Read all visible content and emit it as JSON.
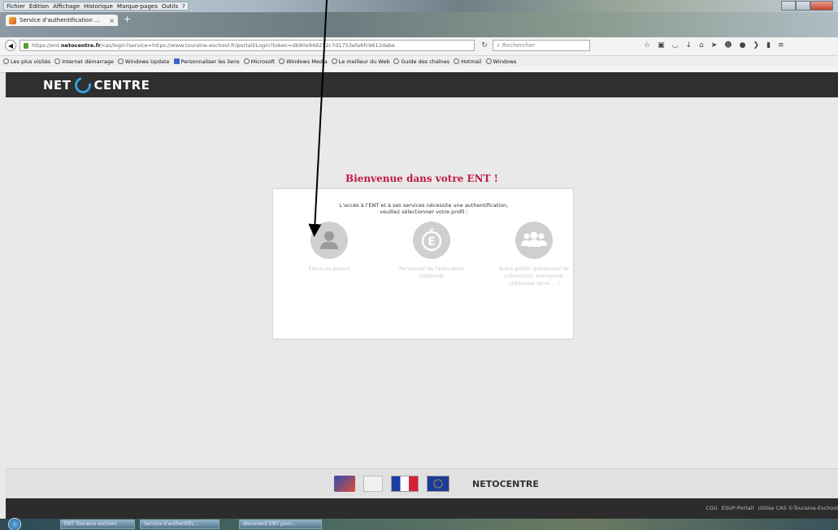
{
  "menubar": [
    "Fichier",
    "Édition",
    "Affichage",
    "Historique",
    "Marque-pages",
    "Outils",
    "?"
  ],
  "tab": {
    "title": "Service d'authentification ...",
    "close": "×",
    "new_tab": "+"
  },
  "nav": {
    "url_prefix": "https://ent.",
    "url_domain": "netocentre.fr",
    "url_rest": "/cas/login?service=https://www.touraine-eschool.fr/portail/Login?token=db90e948252c7d1753efa6fc9612dabe",
    "search_placeholder": "Rechercher",
    "icons": [
      "star-icon",
      "clipboard-icon",
      "pocket-icon",
      "download-icon",
      "home-icon",
      "send-icon",
      "smiley-icon",
      "chat-icon",
      "extension-icon",
      "bookmark-icon",
      "menu-icon"
    ]
  },
  "bookmarks": [
    "Les plus visités",
    "Internet démarrage",
    "Windows Update",
    "Personnaliser les liens",
    "Microsoft",
    "Windows Media",
    "Le meilleur du Web",
    "Guide des chaînes",
    "Hotmail",
    "Windows"
  ],
  "header": {
    "logo_left": "NET",
    "logo_right": "CENTRE"
  },
  "main": {
    "welcome": "Bienvenue dans votre ENT !",
    "intro_line1": "L'accès à l'ENT et à ses services nécessite une authentification,",
    "intro_line2": "veuillez sélectionner votre profil :",
    "profiles": [
      {
        "label": "Élève ou parent",
        "icon": "person-icon"
      },
      {
        "label": "Personnel de l'éducation nationale",
        "icon": "education-icon"
      },
      {
        "label": "Autre public (personnel de collectivité, entreprise, utilisateur local, ...)",
        "icon": "group-icon"
      }
    ]
  },
  "footer": {
    "logo_text": "NETOCENTRE",
    "links": [
      "CGU",
      "ESUP-Portail",
      "Utilise CAS ©Touraine-Eschool"
    ]
  },
  "taskbar": [
    "ENT Touraine eschool",
    "Service d'authentific...",
    "document ENT pour..."
  ]
}
